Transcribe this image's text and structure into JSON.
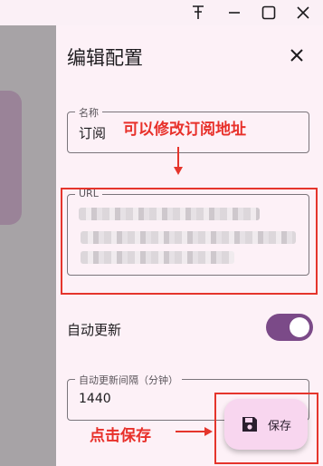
{
  "titlebar": {
    "pin_icon": "pin-icon",
    "minimize_icon": "minimize-icon",
    "maximize_icon": "maximize-icon",
    "close_icon": "close-icon"
  },
  "drawer": {
    "title": "编辑配置",
    "close_icon": "close-icon"
  },
  "form": {
    "name": {
      "label": "名称",
      "value": "订阅"
    },
    "url": {
      "label": "URL"
    },
    "auto_update": {
      "label": "自动更新",
      "enabled": true
    },
    "interval": {
      "label": "自动更新间隔（分钟）",
      "value": "1440"
    }
  },
  "fab": {
    "label": "保存",
    "icon": "save-icon"
  },
  "annotations": {
    "edit_url_note": "可以修改订阅地址",
    "save_note": "点击保存"
  },
  "colors": {
    "accent": "#7b4a88",
    "annotation_red": "#e8302a",
    "drawer_bg": "#fdf1f7",
    "fab_bg": "#f8d6ef"
  }
}
